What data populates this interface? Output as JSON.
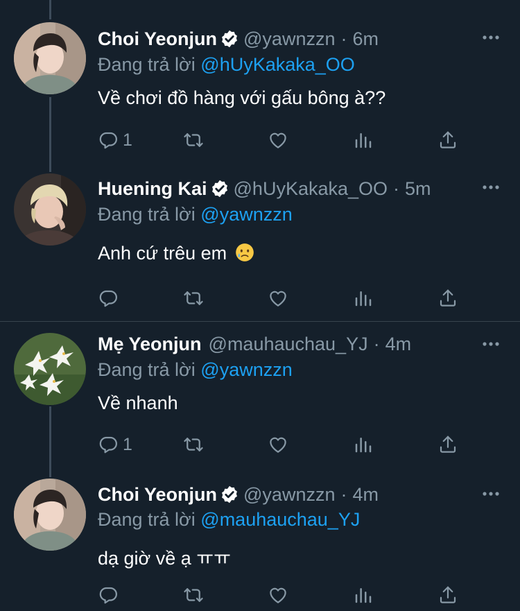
{
  "tweets": [
    {
      "name": "Choi Yeonjun",
      "verified": true,
      "handle": "@yawnzzn",
      "time": "6m",
      "reply_prefix": "Đang trả lời",
      "reply_to": "@hUyKakaka_OO",
      "text": "Về chơi đồ hàng với gấu bông à??",
      "reply_count": "1"
    },
    {
      "name": "Huening Kai",
      "verified": true,
      "handle": "@hUyKakaka_OO",
      "time": "5m",
      "reply_prefix": "Đang trả lời",
      "reply_to": "@yawnzzn",
      "text": "Anh cứ trêu em",
      "emoji": "crying-face-icon",
      "reply_count": ""
    },
    {
      "name": "Mẹ Yeonjun",
      "verified": false,
      "handle": "@mauhauchau_YJ",
      "time": "4m",
      "reply_prefix": "Đang trả lời",
      "reply_to": "@yawnzzn",
      "text": "Về nhanh",
      "reply_count": "1"
    },
    {
      "name": "Choi Yeonjun",
      "verified": true,
      "handle": "@yawnzzn",
      "time": "4m",
      "reply_prefix": "Đang trả lời",
      "reply_to": "@mauhauchau_YJ",
      "text": "dạ giờ về ạ ㅠㅠ",
      "reply_count": ""
    }
  ],
  "colors": {
    "background": "#15202b",
    "muted": "#8899a6",
    "link": "#1da1f2",
    "thread_line": "#3d4b5a"
  },
  "icons": [
    "reply-icon",
    "retweet-icon",
    "like-icon",
    "analytics-icon",
    "share-icon",
    "more-icon",
    "verified-icon"
  ]
}
